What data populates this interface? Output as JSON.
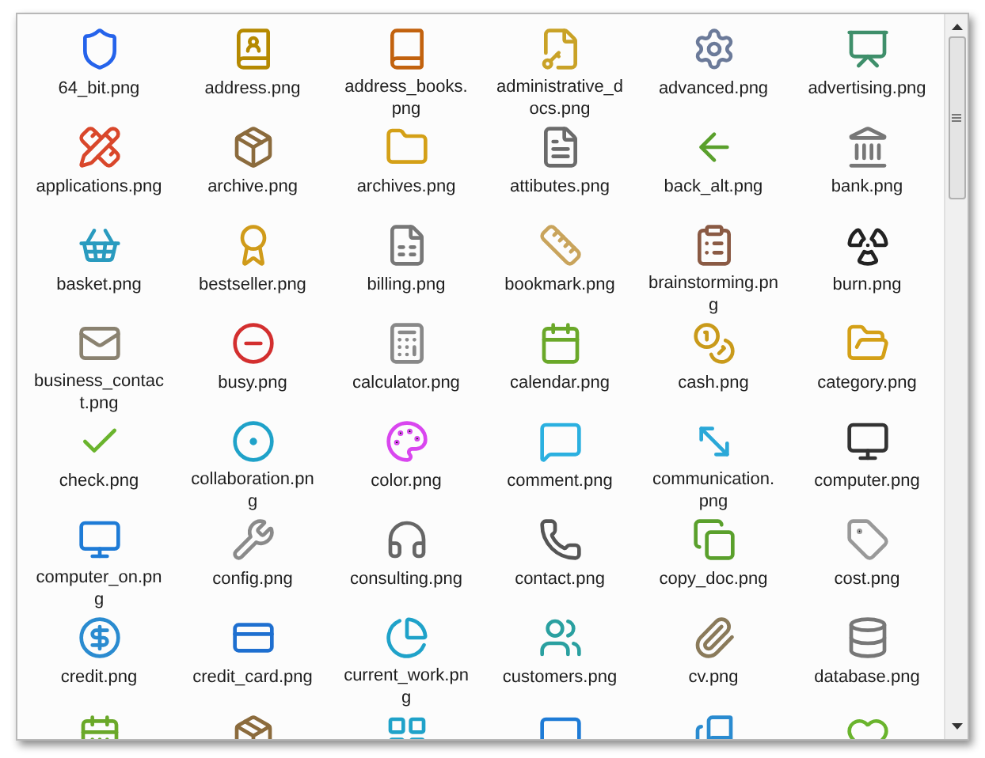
{
  "files": [
    {
      "label": "64_bit.png"
    },
    {
      "label": "address.png"
    },
    {
      "label": "address_books.png"
    },
    {
      "label": "administrative_docs.png"
    },
    {
      "label": "advanced.png"
    },
    {
      "label": "advertising.png"
    },
    {
      "label": "applications.png"
    },
    {
      "label": "archive.png"
    },
    {
      "label": "archives.png"
    },
    {
      "label": "attibutes.png"
    },
    {
      "label": "back_alt.png"
    },
    {
      "label": "bank.png"
    },
    {
      "label": "basket.png"
    },
    {
      "label": "bestseller.png"
    },
    {
      "label": "billing.png"
    },
    {
      "label": "bookmark.png"
    },
    {
      "label": "brainstorming.png"
    },
    {
      "label": "burn.png"
    },
    {
      "label": "business_contact.png"
    },
    {
      "label": "busy.png"
    },
    {
      "label": "calculator.png"
    },
    {
      "label": "calendar.png"
    },
    {
      "label": "cash.png"
    },
    {
      "label": "category.png"
    },
    {
      "label": "check.png"
    },
    {
      "label": "collaboration.png"
    },
    {
      "label": "color.png"
    },
    {
      "label": "comment.png"
    },
    {
      "label": "communication.png"
    },
    {
      "label": "computer.png"
    },
    {
      "label": "computer_on.png"
    },
    {
      "label": "config.png"
    },
    {
      "label": "consulting.png"
    },
    {
      "label": "contact.png"
    },
    {
      "label": "copy_doc.png"
    },
    {
      "label": "cost.png"
    },
    {
      "label": "credit.png"
    },
    {
      "label": "credit_card.png"
    },
    {
      "label": "current_work.png"
    },
    {
      "label": "customers.png"
    },
    {
      "label": "cv.png"
    },
    {
      "label": "database.png"
    }
  ]
}
